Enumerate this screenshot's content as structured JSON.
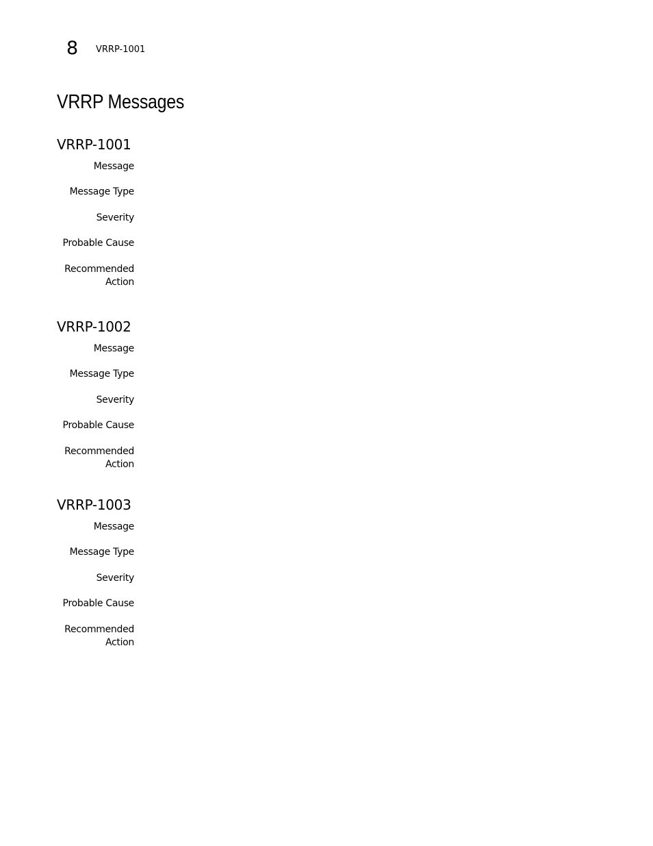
{
  "header": {
    "chapter_number": "8",
    "running_title": "VRRP-1001"
  },
  "page_title": "VRRP Messages",
  "sections": [
    {
      "id": "VRRP-1001",
      "fields": [
        {
          "label": "Message",
          "value": ""
        },
        {
          "label": "Message Type",
          "value": ""
        },
        {
          "label": "Severity",
          "value": ""
        },
        {
          "label": "Probable Cause",
          "value": ""
        },
        {
          "label": "Recommended Action",
          "label_lines": [
            "Recommended",
            "Action"
          ],
          "value": ""
        }
      ]
    },
    {
      "id": "VRRP-1002",
      "fields": [
        {
          "label": "Message",
          "value": ""
        },
        {
          "label": "Message Type",
          "value": ""
        },
        {
          "label": "Severity",
          "value": ""
        },
        {
          "label": "Probable Cause",
          "value": ""
        },
        {
          "label": "Recommended Action",
          "label_lines": [
            "Recommended",
            "Action"
          ],
          "value": ""
        }
      ]
    },
    {
      "id": "VRRP-1003",
      "fields": [
        {
          "label": "Message",
          "value": ""
        },
        {
          "label": "Message Type",
          "value": ""
        },
        {
          "label": "Severity",
          "value": ""
        },
        {
          "label": "Probable Cause",
          "value": ""
        },
        {
          "label": "Recommended Action",
          "label_lines": [
            "Recommended",
            "Action"
          ],
          "value": ""
        }
      ]
    }
  ]
}
